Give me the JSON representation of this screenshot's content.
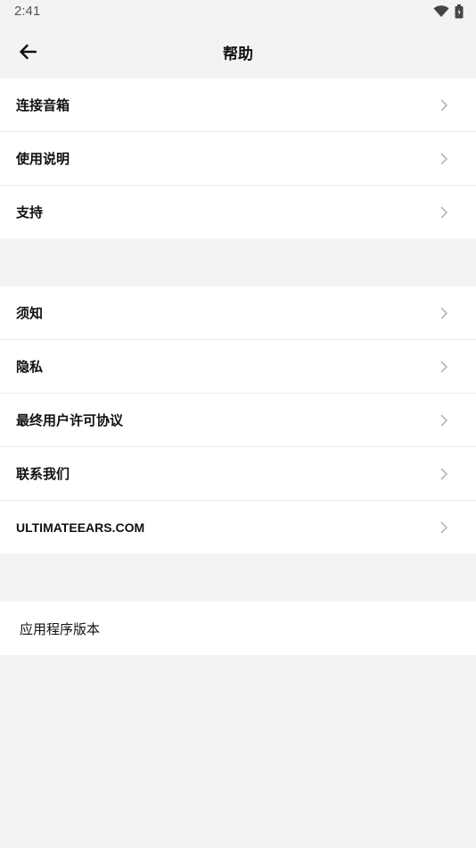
{
  "status": {
    "time": "2:41",
    "icons": [
      "wifi-icon",
      "battery-icon"
    ]
  },
  "header": {
    "title": "帮助",
    "back_icon": "arrow-left-icon"
  },
  "groups": [
    {
      "items": [
        {
          "label": "连接音箱"
        },
        {
          "label": "使用说明"
        },
        {
          "label": "支持"
        }
      ]
    },
    {
      "items": [
        {
          "label": "须知"
        },
        {
          "label": "隐私"
        },
        {
          "label": "最终用户许可协议"
        },
        {
          "label": "联系我们"
        },
        {
          "label": "ULTIMATEEARS.COM"
        }
      ]
    }
  ],
  "version": {
    "label": "应用程序版本"
  },
  "colors": {
    "background": "#f3f3f3",
    "row_background": "#ffffff",
    "divider": "#ececec",
    "chevron": "#b8b8b8",
    "text": "#111111"
  }
}
